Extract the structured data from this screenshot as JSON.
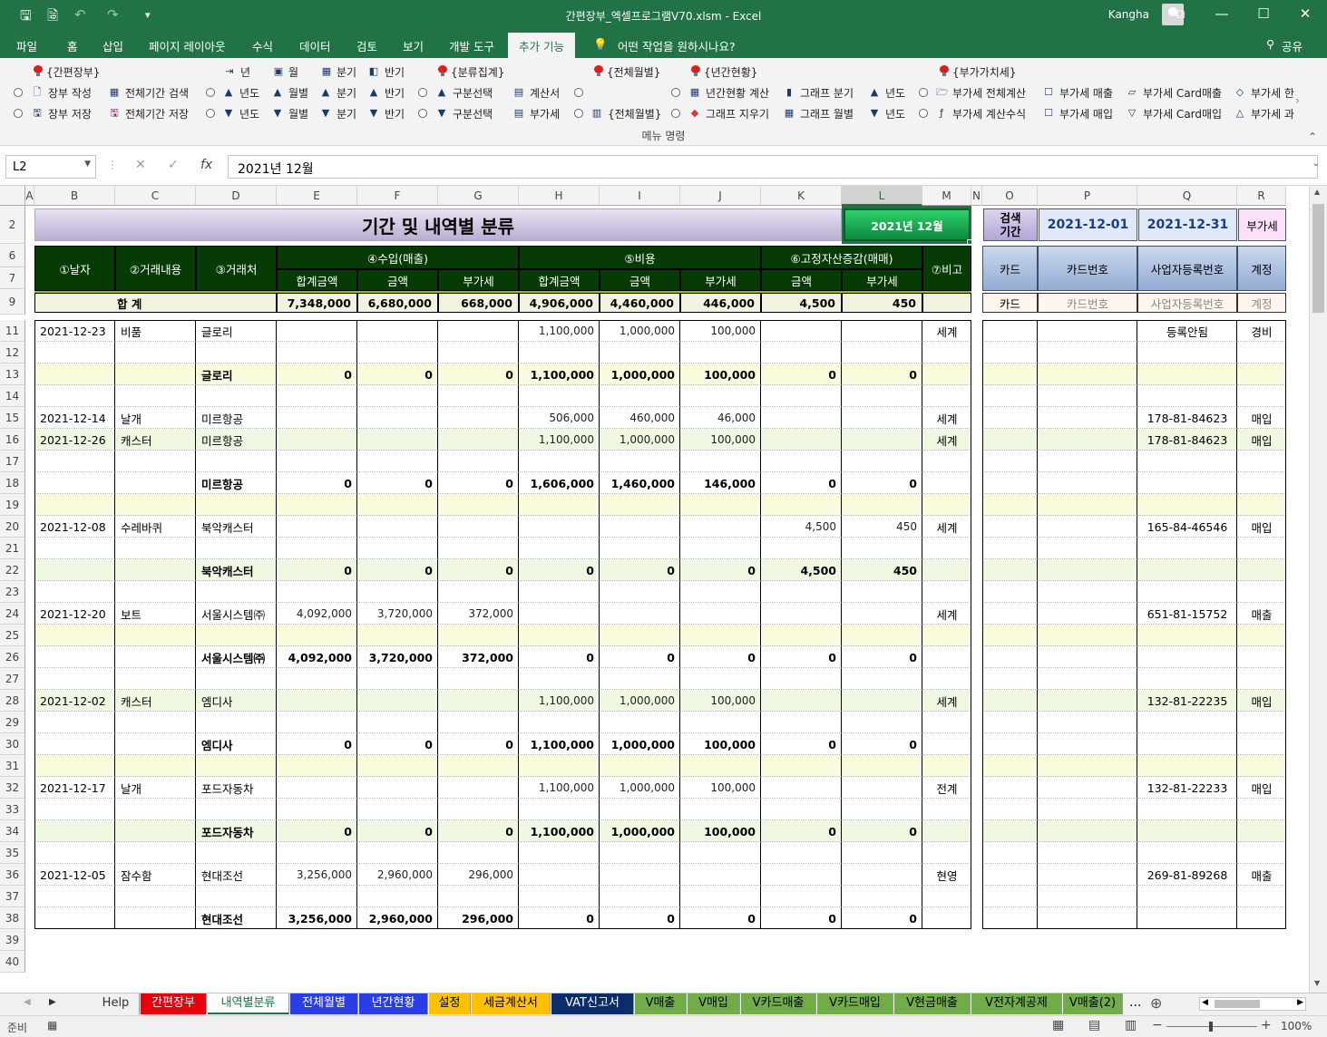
{
  "window": {
    "title": "간편장부_엑셀프로그램V70.xlsm  -  Excel",
    "user": "Kangha",
    "qa_save": "🖫",
    "qa_preview": "🗟",
    "qa_undo": "↶",
    "qa_redo": "↷",
    "qa_custom": "▾",
    "ribbon_display": "⧉",
    "minimize": "—",
    "maximize": "☐",
    "close": "✕"
  },
  "ribbon_tabs": [
    "파일",
    "홈",
    "삽입",
    "페이지 레이아웃",
    "수식",
    "데이터",
    "검토",
    "보기",
    "개발 도구",
    "추가 기능"
  ],
  "active_tab": "추가 기능",
  "tell_me": "어떤 작업을 원하시나요?",
  "share": "공유",
  "ribbon": {
    "headers": [
      "{간편장부}",
      "{분류집계}",
      "{전체월별}",
      "{년간현황}",
      "{부가가치세}"
    ],
    "row0": [
      "년",
      "월",
      "분기",
      "반기"
    ],
    "row1": [
      "장부 작성",
      "전체기간 검색",
      "년도",
      "월별",
      "분기",
      "반기",
      "구분선택",
      "계산서",
      "년간현황 계산",
      "그래프 분기",
      "년도",
      "부가세 전체계산",
      "부가세 매출",
      "부가세 Card매출",
      "부가세 한"
    ],
    "row2": [
      "장부 저장",
      "전체기간 저장",
      "년도",
      "월별",
      "분기",
      "반기",
      "구분선택",
      "부가세",
      "{전체월별}",
      "그래프 지우기",
      "그래프 월별",
      "년도",
      "부가세 계산수식",
      "부가세 매입",
      "부가세 Card매입",
      "부가세 과"
    ],
    "group_label": "메뉴 명령"
  },
  "formula_bar": {
    "name_box": "L2",
    "formula": "2021년 12월"
  },
  "columns": [
    "A",
    "B",
    "C",
    "D",
    "E",
    "F",
    "G",
    "H",
    "I",
    "J",
    "K",
    "L",
    "M",
    "N",
    "O",
    "P",
    "Q",
    "R"
  ],
  "rows": [
    "2",
    "6",
    "7",
    "9",
    "11",
    "12",
    "13",
    "14",
    "15",
    "16",
    "17",
    "18",
    "19",
    "20",
    "21",
    "22",
    "23",
    "24",
    "25",
    "26",
    "27",
    "28",
    "29",
    "30",
    "31",
    "32",
    "33",
    "34",
    "35",
    "36",
    "37",
    "38",
    "39",
    "40"
  ],
  "sheet": {
    "title": "기간 및 내역별 분류",
    "period_button": "2021년 12월",
    "search_label": "검색\n기간",
    "search_start": "2021-12-01",
    "search_end": "2021-12-31",
    "vat_label": "부가세",
    "headers": {
      "date": "①날자",
      "desc": "②거래내용",
      "vendor": "③거래처",
      "income": "④수입(매출)",
      "expense": "⑤비용",
      "asset": "⑥고정자산증감(매매)",
      "note": "⑦비고",
      "total_amount": "합계금액",
      "amount": "금액",
      "vat": "부가세"
    },
    "right_headers": [
      "카드",
      "카드번호",
      "사업자등록번호",
      "계정"
    ],
    "right_sub": [
      "카드",
      "카드번호",
      "사업자등록번호",
      "계정"
    ],
    "total_row": [
      "합      계",
      "7,348,000",
      "6,680,000",
      "668,000",
      "4,906,000",
      "4,460,000",
      "446,000",
      "4,500",
      "450"
    ],
    "data_rows": [
      {
        "row": "11",
        "type": "detail",
        "cells": [
          "2021-12-23",
          "비품",
          "글로리",
          "",
          "",
          "",
          "1,100,000",
          "1,000,000",
          "100,000",
          "",
          "",
          "세계"
        ],
        "right": [
          "",
          "",
          "등록안됨",
          "경비"
        ]
      },
      {
        "row": "13",
        "type": "subtotal",
        "cells": [
          "",
          "",
          "글로리",
          "0",
          "0",
          "0",
          "1,100,000",
          "1,000,000",
          "100,000",
          "0",
          "0",
          ""
        ],
        "right": [
          "",
          "",
          "",
          ""
        ]
      },
      {
        "row": "15",
        "type": "detail",
        "cells": [
          "2021-12-14",
          "날개",
          "미르항공",
          "",
          "",
          "",
          "506,000",
          "460,000",
          "46,000",
          "",
          "",
          "세계"
        ],
        "right": [
          "",
          "",
          "178-81-84623",
          "매입"
        ]
      },
      {
        "row": "16",
        "type": "detail",
        "cells": [
          "2021-12-26",
          "캐스터",
          "미르항공",
          "",
          "",
          "",
          "1,100,000",
          "1,000,000",
          "100,000",
          "",
          "",
          "세계"
        ],
        "right": [
          "",
          "",
          "178-81-84623",
          "매입"
        ]
      },
      {
        "row": "18",
        "type": "subtotal",
        "cells": [
          "",
          "",
          "미르항공",
          "0",
          "0",
          "0",
          "1,606,000",
          "1,460,000",
          "146,000",
          "0",
          "0",
          ""
        ],
        "right": [
          "",
          "",
          "",
          ""
        ]
      },
      {
        "row": "20",
        "type": "detail",
        "cells": [
          "2021-12-08",
          "수레바퀴",
          "북악캐스터",
          "",
          "",
          "",
          "",
          "",
          "",
          "4,500",
          "450",
          "세계"
        ],
        "right": [
          "",
          "",
          "165-84-46546",
          "매입"
        ]
      },
      {
        "row": "22",
        "type": "subtotal",
        "cells": [
          "",
          "",
          "북악캐스터",
          "0",
          "0",
          "0",
          "0",
          "0",
          "0",
          "4,500",
          "450",
          ""
        ],
        "right": [
          "",
          "",
          "",
          ""
        ]
      },
      {
        "row": "24",
        "type": "detail",
        "cells": [
          "2021-12-20",
          "보트",
          "서울시스템㈜",
          "4,092,000",
          "3,720,000",
          "372,000",
          "",
          "",
          "",
          "",
          "",
          "세계"
        ],
        "right": [
          "",
          "",
          "651-81-15752",
          "매출"
        ]
      },
      {
        "row": "26",
        "type": "subtotal",
        "cells": [
          "",
          "",
          "서울시스템㈜",
          "4,092,000",
          "3,720,000",
          "372,000",
          "0",
          "0",
          "0",
          "0",
          "0",
          ""
        ],
        "right": [
          "",
          "",
          "",
          ""
        ]
      },
      {
        "row": "28",
        "type": "detail",
        "cells": [
          "2021-12-02",
          "캐스터",
          "엠디사",
          "",
          "",
          "",
          "1,100,000",
          "1,000,000",
          "100,000",
          "",
          "",
          "세계"
        ],
        "right": [
          "",
          "",
          "132-81-22235",
          "매입"
        ]
      },
      {
        "row": "30",
        "type": "subtotal",
        "cells": [
          "",
          "",
          "엠디사",
          "0",
          "0",
          "0",
          "1,100,000",
          "1,000,000",
          "100,000",
          "0",
          "0",
          ""
        ],
        "right": [
          "",
          "",
          "",
          ""
        ]
      },
      {
        "row": "32",
        "type": "detail",
        "cells": [
          "2021-12-17",
          "날개",
          "포드자동차",
          "",
          "",
          "",
          "1,100,000",
          "1,000,000",
          "100,000",
          "",
          "",
          "전계"
        ],
        "right": [
          "",
          "",
          "132-81-22233",
          "매입"
        ]
      },
      {
        "row": "34",
        "type": "subtotal",
        "cells": [
          "",
          "",
          "포드자동차",
          "0",
          "0",
          "0",
          "1,100,000",
          "1,000,000",
          "100,000",
          "0",
          "0",
          ""
        ],
        "right": [
          "",
          "",
          "",
          ""
        ]
      },
      {
        "row": "36",
        "type": "detail",
        "cells": [
          "2021-12-05",
          "잠수함",
          "현대조선",
          "3,256,000",
          "2,960,000",
          "296,000",
          "",
          "",
          "",
          "",
          "",
          "현영"
        ],
        "right": [
          "",
          "",
          "269-81-89268",
          "매출"
        ]
      },
      {
        "row": "38",
        "type": "subtotal",
        "cells": [
          "",
          "",
          "현대조선",
          "3,256,000",
          "2,960,000",
          "296,000",
          "0",
          "0",
          "0",
          "0",
          "0",
          ""
        ],
        "right": [
          "",
          "",
          "",
          ""
        ]
      }
    ]
  },
  "sheet_tabs": [
    {
      "label": "Help",
      "bg": "#f0f0f0",
      "fg": "#333"
    },
    {
      "label": "간편장부",
      "bg": "#e8000d",
      "fg": "#ffffff"
    },
    {
      "label": "내역별분류",
      "bg": "#ffffff",
      "fg": "#217346"
    },
    {
      "label": "전체월별",
      "bg": "#2a3ee8",
      "fg": "#ffffff"
    },
    {
      "label": "년간현황",
      "bg": "#2a3ee8",
      "fg": "#ffffff"
    },
    {
      "label": "설정",
      "bg": "#ffc000",
      "fg": "#000000"
    },
    {
      "label": "세금계산서",
      "bg": "#ffc000",
      "fg": "#000000"
    },
    {
      "label": "VAT신고서",
      "bg": "#0b2d6b",
      "fg": "#ffffff"
    },
    {
      "label": "V매출",
      "bg": "#70ad47",
      "fg": "#000000"
    },
    {
      "label": "V매입",
      "bg": "#70ad47",
      "fg": "#000000"
    },
    {
      "label": "V카드매출",
      "bg": "#70ad47",
      "fg": "#000000"
    },
    {
      "label": "V카드매입",
      "bg": "#70ad47",
      "fg": "#000000"
    },
    {
      "label": "V현금매출",
      "bg": "#70ad47",
      "fg": "#000000"
    },
    {
      "label": "V전자계공제",
      "bg": "#70ad47",
      "fg": "#000000"
    },
    {
      "label": "V매출(2)",
      "bg": "#70ad47",
      "fg": "#000000"
    }
  ],
  "more_tabs": "...",
  "status": {
    "ready": "준비",
    "zoom": "100%"
  }
}
